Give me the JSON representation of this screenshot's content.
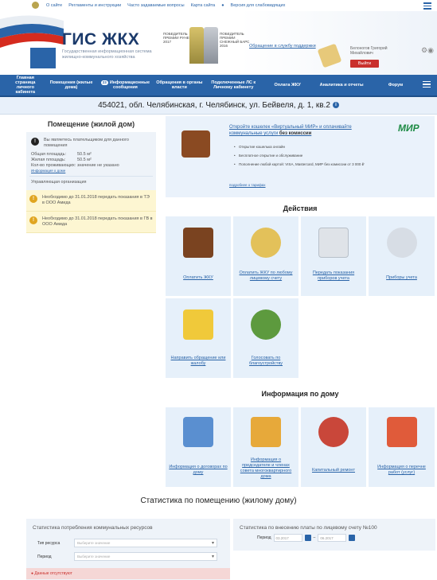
{
  "topbar": {
    "links": [
      "О сайте",
      "Регламенты и инструкции",
      "Часто задаваемые вопросы",
      "Карта сайта",
      "Версия для слабовидящих"
    ]
  },
  "header": {
    "logo_title": "ГИС ЖКХ",
    "logo_subtitle": "Государственная информационная система жилищно-коммунального хозяйства",
    "award1": "ПОБЕДИТЕЛЬ ПРЕМИИ РУНЕТА 2017",
    "award2": "ПОБЕДИТЕЛЬ ПРЕМИИ СНЕЖНЫЙ БАРС 2016",
    "support_link": "Обращение в службу поддержки",
    "user_name": "Белоногов Григорий Михайлович",
    "logout_label": "Выйти"
  },
  "nav": {
    "items": [
      "Главная страница личного кабинета",
      "Помещения (жилые дома)",
      "Информационные сообщения",
      "Обращения в органы власти",
      "Подключенные ЛС к Личному кабинету",
      "Оплата ЖКУ",
      "Аналитика и отчеты",
      "Форум"
    ],
    "badge": "23"
  },
  "address": "454021, обл. Челябинская, г. Челябинск, ул. Бейвеля, д. 1, кв.2",
  "left": {
    "title": "Помещение (жилой дом)",
    "owner_note": "Вы являетесь плательщиком для данного помещения",
    "rows": [
      {
        "k": "Общая площадь:",
        "v": "50.5 м²"
      },
      {
        "k": "Жилая площадь:",
        "v": "50.5 м²"
      },
      {
        "k": "Кол-во проживающих:",
        "v": "значение не указано"
      }
    ],
    "house_info_link": "Информация о доме",
    "mgmt": "Управляющая организация",
    "notices": [
      "Необходимо до 31.01.2018 передать показания в ТЭ в ООО Амида",
      "Необходимо до 31.01.2018 передать показания в ГВ в ООО Амида"
    ]
  },
  "promo": {
    "title_link": "Откройте кошелек «Виртуальный МИР» и оплачивайте коммунальные услуги",
    "title_bold": "без комиссии",
    "bullets": [
      "Открытие кошелька онлайн",
      "Бесплатное открытие и обслуживание",
      "Пополнение любой картой: VISA, Mastercard, МИР без комиссии от 3 000 ₽"
    ],
    "more": "подробнее о тарифах",
    "brand": "МИР"
  },
  "actions": {
    "title": "Действия",
    "tiles": [
      "Оплатить ЖКУ",
      "Оплатить ЖКУ по любому лицевому счету",
      "Передать показания приборов учета",
      "Приборы учета",
      "Направить обращение или жалобу",
      "Голосовать по благоустройству"
    ]
  },
  "house_info": {
    "title": "Информация по дому",
    "tiles": [
      "Информация о договорах по дому",
      "Информация о председателе и членах совета многоквартирного дома",
      "Капитальный ремонт",
      "Информация о перечне работ (услуг)"
    ]
  },
  "stats": {
    "title": "Статистика по помещению (жилому дому)",
    "consumption_title": "Статистика потребления коммунальных ресурсов",
    "resource_type_label": "Тип ресурса",
    "resource_type_placeholder": "Выберите значение",
    "period_label": "Период",
    "period_placeholder": "Выберите значение",
    "no_data": "Данные отсутствуют",
    "payment_title": "Статистика по внесению платы по лицевому счету №100",
    "payment_period_label": "Период",
    "date_from": "03.2017",
    "date_to": "06.2017"
  }
}
